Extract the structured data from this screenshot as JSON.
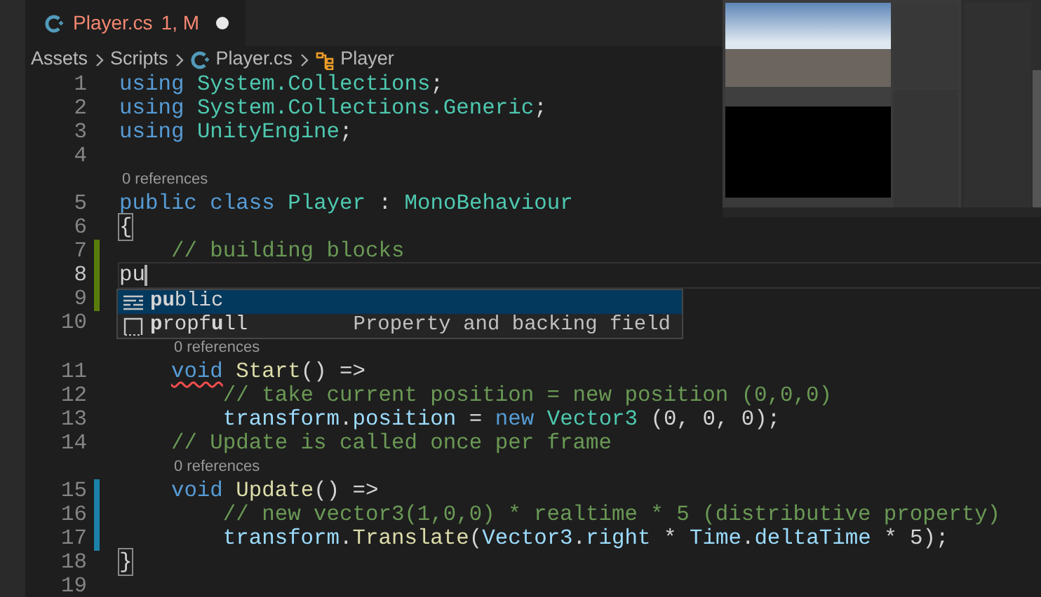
{
  "tabs": [
    {
      "title": "Player.cs",
      "badge": "1, M",
      "dirty": true,
      "selected": true,
      "has_errors": true
    }
  ],
  "breadcrumbs": [
    {
      "text": "Assets",
      "kind": "folder"
    },
    {
      "text": "Scripts",
      "kind": "folder"
    },
    {
      "text": "Player.cs",
      "kind": "csharp-file"
    },
    {
      "text": "Player",
      "kind": "class"
    }
  ],
  "lines": [
    {
      "number": "1",
      "current": false,
      "tokens": [
        {
          "text": "using",
          "kind": "keyword"
        },
        {
          "text": " System.Collections",
          "kind": "type"
        },
        {
          "text": ";",
          "kind": "plain"
        }
      ]
    },
    {
      "number": "2",
      "current": false,
      "tokens": [
        {
          "text": "using",
          "kind": "keyword"
        },
        {
          "text": " System.Collections.Generic",
          "kind": "type"
        },
        {
          "text": ";",
          "kind": "plain"
        }
      ]
    },
    {
      "number": "3",
      "current": false,
      "tokens": [
        {
          "text": "using",
          "kind": "keyword"
        },
        {
          "text": " UnityEngine",
          "kind": "type"
        },
        {
          "text": ";",
          "kind": "plain"
        }
      ]
    },
    {
      "number": "4",
      "current": false
    },
    {
      "number": "5",
      "current": false,
      "codelens": "0 references",
      "tokens": [
        {
          "text": "public",
          "kind": "keyword"
        },
        {
          "text": " class",
          "kind": "keyword"
        },
        {
          "text": " Player",
          "kind": "type"
        },
        {
          "text": " :",
          "kind": "plain"
        },
        {
          "text": " MonoBehaviour",
          "kind": "type"
        }
      ]
    },
    {
      "number": "6",
      "current": false,
      "tokens": [
        {
          "text": "{",
          "kind": "bracket-match"
        }
      ]
    },
    {
      "number": "7",
      "current": false,
      "added": true,
      "tokens": [
        {
          "text": "    // building blocks",
          "kind": "comment"
        }
      ]
    },
    {
      "number": "8",
      "current": true,
      "added": true,
      "tokens": [
        {
          "text": "pu",
          "kind": "plain"
        }
      ]
    },
    {
      "number": "9",
      "current": false,
      "added": true
    },
    {
      "number": "10",
      "current": false
    },
    {
      "number": "11",
      "current": false,
      "codelens": "0 references",
      "tokens": [
        {
          "text": "    void",
          "kind": "keyword-error"
        },
        {
          "text": " Start",
          "kind": "function"
        },
        {
          "text": "() =>",
          "kind": "plain"
        }
      ]
    },
    {
      "number": "12",
      "current": false,
      "tokens": [
        {
          "text": "        // take current position = new position (0,0,0)",
          "kind": "comment"
        }
      ]
    },
    {
      "number": "13",
      "current": false,
      "tokens": [
        {
          "text": "        transform",
          "kind": "variable"
        },
        {
          "text": ".",
          "kind": "plain"
        },
        {
          "text": "position",
          "kind": "variable"
        },
        {
          "text": " =",
          "kind": "plain"
        },
        {
          "text": " new",
          "kind": "keyword"
        },
        {
          "text": " Vector3",
          "kind": "type"
        },
        {
          "text": " (0, 0, 0);",
          "kind": "plain"
        }
      ]
    },
    {
      "number": "14",
      "current": false,
      "tokens": [
        {
          "text": "    // Update is called once per frame",
          "kind": "comment"
        }
      ]
    },
    {
      "number": "15",
      "current": false,
      "codelens": "0 references",
      "modified": true,
      "tokens": [
        {
          "text": "    void",
          "kind": "keyword"
        },
        {
          "text": " Update",
          "kind": "function"
        },
        {
          "text": "() =>",
          "kind": "plain"
        }
      ]
    },
    {
      "number": "16",
      "current": false,
      "modified": true,
      "tokens": [
        {
          "text": "        // new vector3(1,0,0) * realtime * 5 (distributive property)",
          "kind": "comment"
        }
      ]
    },
    {
      "number": "17",
      "current": false,
      "modified": true,
      "tokens": [
        {
          "text": "        transform",
          "kind": "variable"
        },
        {
          "text": ".",
          "kind": "plain"
        },
        {
          "text": "Translate",
          "kind": "function"
        },
        {
          "text": "(",
          "kind": "plain"
        },
        {
          "text": "Vector3",
          "kind": "variable"
        },
        {
          "text": ".",
          "kind": "plain"
        },
        {
          "text": "right",
          "kind": "variable"
        },
        {
          "text": " *",
          "kind": "plain"
        },
        {
          "text": " Time",
          "kind": "variable"
        },
        {
          "text": ".",
          "kind": "plain"
        },
        {
          "text": "deltaTime",
          "kind": "variable"
        },
        {
          "text": " * 5);",
          "kind": "plain"
        }
      ]
    },
    {
      "number": "18",
      "current": false,
      "tokens": [
        {
          "text": "}",
          "kind": "bracket-match"
        }
      ]
    },
    {
      "number": "19",
      "current": false
    }
  ],
  "suggestions": [
    {
      "label": "**pu**blic",
      "kind": "keyword",
      "selected": true
    },
    {
      "label": "**p**ropf**u**ll",
      "kind": "snippet",
      "selected": false,
      "detail": "Property and backing field"
    }
  ]
}
